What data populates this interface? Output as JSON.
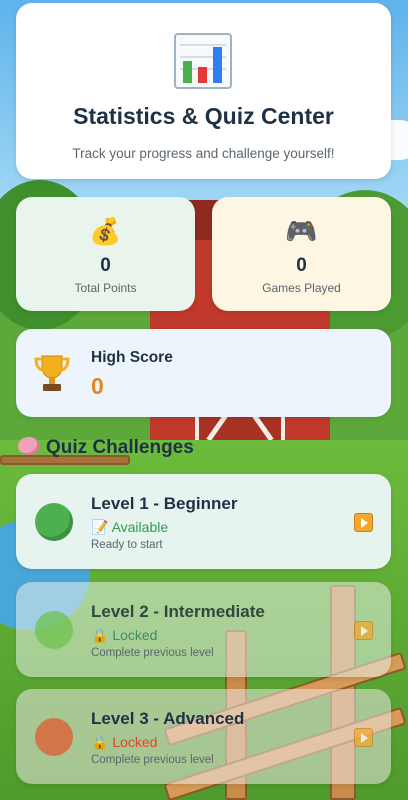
{
  "header": {
    "icon": "bar-chart-icon",
    "title": "Statistics & Quiz Center",
    "subtitle": "Track your progress and challenge yourself!"
  },
  "stats": [
    {
      "icon": "money-bag-icon",
      "glyph": "💰",
      "value": "0",
      "label": "Total Points"
    },
    {
      "icon": "gamepad-icon",
      "glyph": "🎮",
      "value": "0",
      "label": "Games Played"
    }
  ],
  "high_score": {
    "icon": "trophy-icon",
    "label": "High Score",
    "value": "0"
  },
  "quiz": {
    "section_icon": "brain-icon",
    "section_title": "Quiz Challenges",
    "levels": [
      {
        "title": "Level 1 - Beginner",
        "status_icon": "memo-icon",
        "status_glyph": "📝",
        "status": "Available",
        "hint": "Ready to start",
        "color": "#4caf50",
        "status_color": "#2e9e4f",
        "action_icon": "play-icon"
      },
      {
        "title": "Level 2 - Intermediate",
        "status_icon": "lock-icon",
        "status_glyph": "🔒",
        "status": "Locked",
        "hint": "Complete previous level",
        "color": "#6cc04a",
        "status_color": "#3f8f58",
        "action_icon": "play-icon"
      },
      {
        "title": "Level 3 - Advanced",
        "status_icon": "lock-icon",
        "status_glyph": "🔒",
        "status": "Locked",
        "hint": "Complete previous level",
        "color": "#e2572b",
        "status_color": "#d9482b",
        "action_icon": "play-icon"
      }
    ]
  }
}
